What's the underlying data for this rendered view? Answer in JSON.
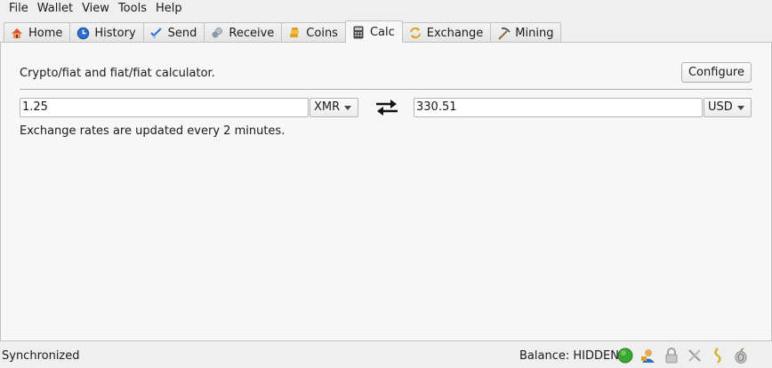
{
  "menu": [
    "File",
    "Wallet",
    "View",
    "Tools",
    "Help"
  ],
  "tabs": [
    {
      "label": "Home",
      "icon": "home-icon"
    },
    {
      "label": "History",
      "icon": "history-icon"
    },
    {
      "label": "Send",
      "icon": "send-icon"
    },
    {
      "label": "Receive",
      "icon": "receive-icon"
    },
    {
      "label": "Coins",
      "icon": "coins-icon"
    },
    {
      "label": "Calc",
      "icon": "calculator-icon",
      "active": true
    },
    {
      "label": "Exchange",
      "icon": "exchange-icon"
    },
    {
      "label": "Mining",
      "icon": "pickaxe-icon"
    }
  ],
  "calc": {
    "description": "Crypto/fiat and fiat/fiat calculator.",
    "configure_label": "Configure",
    "left_amount": "1.25",
    "left_currency": "XMR",
    "right_amount": "330.51",
    "right_currency": "USD",
    "note": "Exchange rates are updated every 2 minutes."
  },
  "statusbar": {
    "status": "Synchronized",
    "balance": "Balance: HIDDEN"
  },
  "colors": {
    "status_ok": "#3aa830",
    "panel_bg": "#f7f7f7",
    "window_bg": "#efefef"
  }
}
